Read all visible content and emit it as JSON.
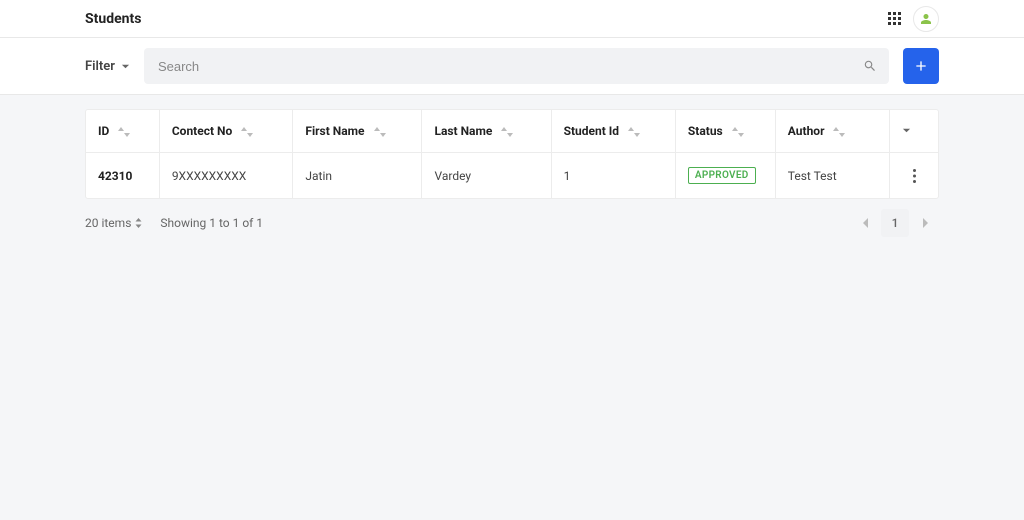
{
  "header": {
    "title": "Students"
  },
  "toolbar": {
    "filter_label": "Filter",
    "search_placeholder": "Search"
  },
  "table": {
    "columns": [
      "ID",
      "Contect No",
      "First Name",
      "Last Name",
      "Student Id",
      "Status",
      "Author"
    ],
    "rows": [
      {
        "id": "42310",
        "contact": "9XXXXXXXXX",
        "first_name": "Jatin",
        "last_name": "Vardey",
        "student_id": "1",
        "status": "APPROVED",
        "author": "Test Test"
      }
    ]
  },
  "footer": {
    "items_per_page": "20 items",
    "showing": "Showing 1 to 1 of 1",
    "current_page": "1"
  },
  "colors": {
    "primary": "#2563eb",
    "success": "#4caf50"
  }
}
